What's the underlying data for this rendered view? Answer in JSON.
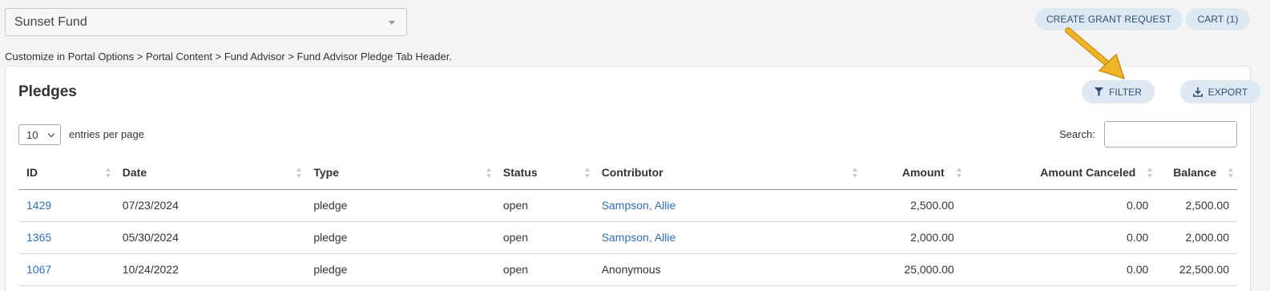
{
  "fund_selector": {
    "value": "Sunset Fund"
  },
  "header_buttons": {
    "grant": "CREATE GRANT REQUEST",
    "cart": "CART (1)"
  },
  "hint": "Customize in Portal Options > Portal Content > Fund Advisor > Fund Advisor Pledge Tab Header.",
  "panel": {
    "title": "Pledges",
    "filter": "FILTER",
    "export": "EXPORT",
    "entries_value": "10",
    "entries_label": "entries per page",
    "search_label": "Search:",
    "search_value": ""
  },
  "table": {
    "columns": [
      "ID",
      "Date",
      "Type",
      "Status",
      "Contributor",
      "Amount",
      "Amount Canceled",
      "Balance"
    ],
    "rows": [
      {
        "id": "1429",
        "date": "07/23/2024",
        "type": "pledge",
        "status": "open",
        "contributor": "Sampson, Allie",
        "contributor_link": true,
        "amount": "2,500.00",
        "canceled": "0.00",
        "balance": "2,500.00"
      },
      {
        "id": "1365",
        "date": "05/30/2024",
        "type": "pledge",
        "status": "open",
        "contributor": "Sampson, Allie",
        "contributor_link": true,
        "amount": "2,000.00",
        "canceled": "0.00",
        "balance": "2,000.00"
      },
      {
        "id": "1067",
        "date": "10/24/2022",
        "type": "pledge",
        "status": "open",
        "contributor": "Anonymous",
        "contributor_link": false,
        "amount": "25,000.00",
        "canceled": "0.00",
        "balance": "22,500.00"
      }
    ]
  },
  "colors": {
    "accent": "#2f6fb8",
    "pill_bg": "#dde8f3",
    "annotation_arrow": "#f0b429"
  },
  "icons": {
    "filter": "funnel-icon",
    "export": "download-icon",
    "sort": "sort-icon"
  }
}
